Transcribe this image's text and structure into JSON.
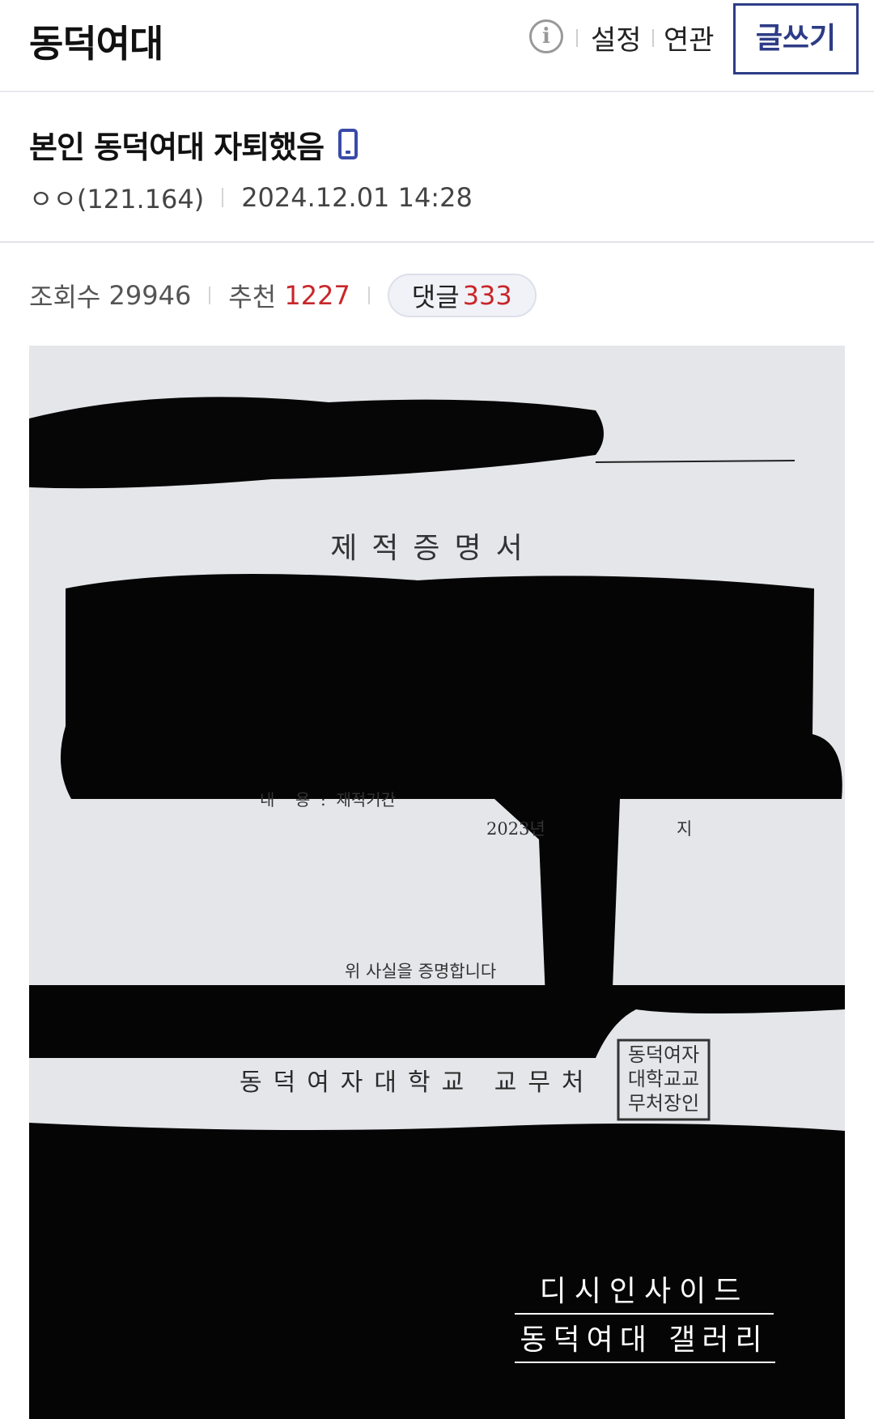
{
  "header": {
    "gallery_title": "동덕여대",
    "info_icon_glyph": "i",
    "settings_label": "설정",
    "related_label": "연관",
    "write_label": "글쓰기"
  },
  "post": {
    "title": "본인 동덕여대 자퇴했음",
    "author": "ㅇㅇ(121.164)",
    "datetime": "2024.12.01 14:28",
    "views_label": "조회수",
    "views_value": "29946",
    "recommend_label": "추천",
    "recommend_value": "1227",
    "comments_label": "댓글",
    "comments_value": "333"
  },
  "document_image": {
    "heading": "제적증명서",
    "content_line": "내    용  :  재적기간",
    "year_text": "2023년",
    "year_suffix": "지",
    "certify_line": "위 사실을 증명합니다",
    "institution_line": "동덕여자대학교 교무처",
    "seal_line_1": "동덕여자",
    "seal_line_2": "대학교교",
    "seal_line_3": "무처장인",
    "watermark_line_1": "디시인사이드",
    "watermark_line_2": "동덕여대 갤러리"
  },
  "colors": {
    "accent": "#2e3c86",
    "highlight": "#c8262a",
    "mobile_icon": "#3a4aa8"
  },
  "icons": {
    "info": "info-circle-icon",
    "mobile": "mobile-phone-icon"
  }
}
